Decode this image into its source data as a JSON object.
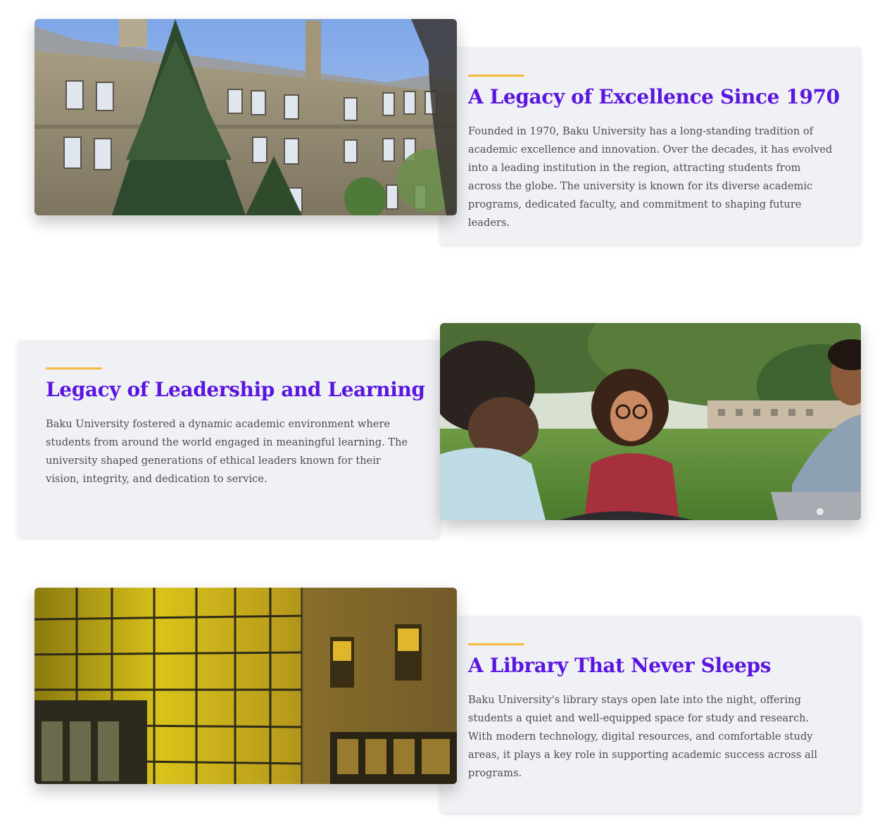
{
  "sections": [
    {
      "heading": "A Legacy of Excellence Since 1970",
      "body": "Founded in 1970, Baku University has a long-standing tradition of academic excellence and innovation. Over the decades, it has evolved into a leading institution in the region, attracting students from across the globe. The university is known for its diverse academic programs, dedicated faculty, and commitment to shaping future leaders."
    },
    {
      "heading": "Legacy of Leadership and Learning",
      "body": "Baku University fostered a dynamic academic environment where students from around the world engaged in meaningful learning. The university shaped generations of ethical leaders known for their vision, integrity, and dedication to service."
    },
    {
      "heading": "A Library That Never Sleeps",
      "body": "Baku University's library stays open late into the night, offering students a quiet and well-equipped space for study and research. With modern technology, digital resources, and comfortable study areas, it plays a key role in supporting academic success across all programs."
    }
  ],
  "colors": {
    "heading": "#5a16e0",
    "accent": "#f6b93b",
    "card_background": "#f0f1f5",
    "body_text": "#4b4b55"
  }
}
